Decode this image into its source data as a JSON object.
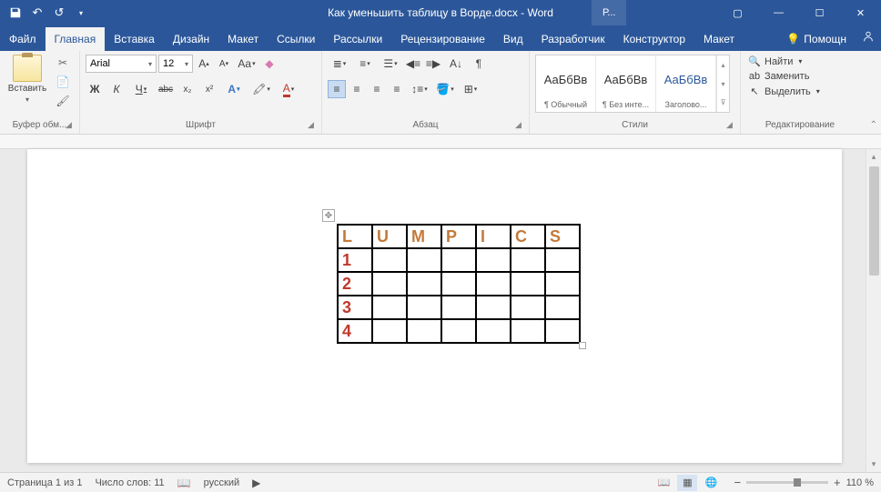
{
  "titlebar": {
    "title": "Как уменьшить таблицу в Ворде.docx - Word",
    "contextual": "Р..."
  },
  "tabs": {
    "file": "Файл",
    "home": "Главная",
    "insert": "Вставка",
    "design": "Дизайн",
    "layout": "Макет",
    "references": "Ссылки",
    "mailings": "Рассылки",
    "review": "Рецензирование",
    "view": "Вид",
    "developer": "Разработчик",
    "table_design": "Конструктор",
    "table_layout": "Макет",
    "help": "Помощн"
  },
  "ribbon": {
    "clipboard": {
      "label": "Буфер обм...",
      "paste": "Вставить"
    },
    "font": {
      "label": "Шрифт",
      "name": "Arial",
      "size": "12",
      "bold": "Ж",
      "italic": "К",
      "underline": "Ч",
      "strike": "abc",
      "sub": "x₂",
      "sup": "x²",
      "grow": "A",
      "shrink": "A",
      "case": "Aa"
    },
    "paragraph": {
      "label": "Абзац"
    },
    "styles": {
      "label": "Стили",
      "preview": "АаБбВв",
      "items": [
        "¶ Обычный",
        "¶ Без инте...",
        "Заголово..."
      ]
    },
    "editing": {
      "label": "Редактирование",
      "find": "Найти",
      "replace": "Заменить",
      "select": "Выделить"
    }
  },
  "table": {
    "header": [
      "L",
      "U",
      "M",
      "P",
      "I",
      "C",
      "S"
    ],
    "rows": [
      "1",
      "2",
      "3",
      "4"
    ]
  },
  "status": {
    "page": "Страница 1 из 1",
    "words": "Число слов: 11",
    "lang": "русский",
    "zoom": "110 %"
  }
}
